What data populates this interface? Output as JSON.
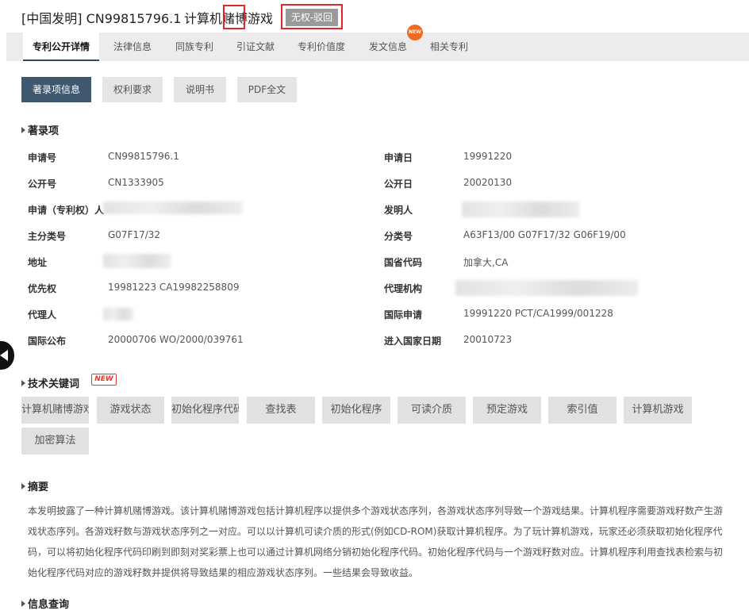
{
  "header": {
    "patent_number": "[中国发明] CN99815796.1",
    "title": "计算机赌博游戏",
    "status": "无权-驳回"
  },
  "tabs": [
    {
      "label": "专利公开详情",
      "active": true
    },
    {
      "label": "法律信息"
    },
    {
      "label": "同族专利"
    },
    {
      "label": "引证文献"
    },
    {
      "label": "专利价值度"
    },
    {
      "label": "发文信息"
    },
    {
      "label": "相关专利"
    }
  ],
  "new_badge": "NEW",
  "buttons": [
    "著录项信息",
    "权利要求",
    "说明书",
    "PDF全文"
  ],
  "sections": {
    "bibliographic": "著录项",
    "keywords": "技术关键词",
    "abstract": "摘要",
    "info_query": "信息查询"
  },
  "fields": {
    "application_no": {
      "label": "申请号",
      "value": "CN99815796.1"
    },
    "application_date": {
      "label": "申请日",
      "value": "19991220"
    },
    "publication_no": {
      "label": "公开号",
      "value": "CN1333905"
    },
    "publication_date": {
      "label": "公开日",
      "value": "20020130"
    },
    "applicant": {
      "label": "申请（专利权）人",
      "value": ""
    },
    "inventor": {
      "label": "发明人",
      "value": ""
    },
    "main_class": {
      "label": "主分类号",
      "value": "G07F17/32"
    },
    "classification": {
      "label": "分类号",
      "value": "A63F13/00 G07F17/32 G06F19/00"
    },
    "address": {
      "label": "地址",
      "value": ""
    },
    "country_code": {
      "label": "国省代码",
      "value": "加拿大,CA"
    },
    "priority": {
      "label": "优先权",
      "value": "19981223 CA19982258809"
    },
    "agency": {
      "label": "代理机构",
      "value": ""
    },
    "agent": {
      "label": "代理人",
      "value": ""
    },
    "intl_application": {
      "label": "国际申请",
      "value": "19991220 PCT/CA1999/001228"
    },
    "intl_publication": {
      "label": "国际公布",
      "value": "20000706 WO/2000/039761"
    },
    "national_entry_date": {
      "label": "进入国家日期",
      "value": "20010723"
    }
  },
  "keywords_new_tag": "NEW",
  "keywords": [
    "计算机赌博游戏",
    "游戏状态",
    "初始化程序代码",
    "查找表",
    "初始化程序",
    "可读介质",
    "预定游戏",
    "索引值",
    "计算机游戏",
    "加密算法"
  ],
  "abstract_text": "本发明披露了一种计算机赌博游戏。该计算机赌博游戏包括计算机程序以提供多个游戏状态序列，各游戏状态序列导致一个游戏结果。计算机程序需要游戏籽数产生游戏状态序列。各游戏籽数与游戏状态序列之一对应。可以以计算机可读介质的形式(例如CD-ROM)获取计算机程序。为了玩计算机游戏，玩家还必须获取初始化程序代码，可以将初始化程序代码印刷到即刻对奖彩票上也可以通过计算机网络分销初始化程序代码。初始化程序代码与一个游戏籽数对应。计算机程序利用查找表检索与初始化程序代码对应的游戏籽数并提供将导致结果的相应游戏状态序列。一些结果会导致收益。",
  "colors": {
    "accent": "#3e5870",
    "highlight": "#e5252a",
    "new": "#e23a2a"
  }
}
